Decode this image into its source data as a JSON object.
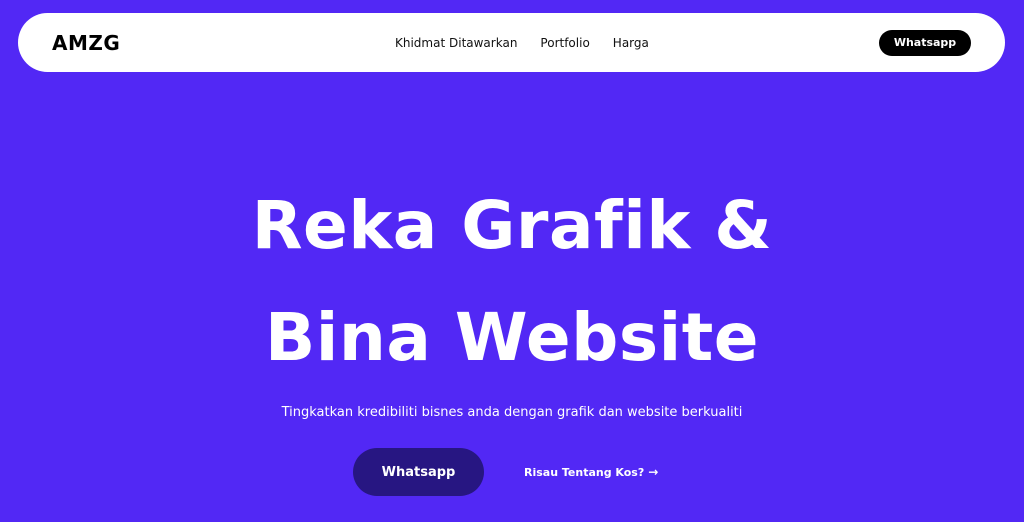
{
  "brand": {
    "logo": "AMZG"
  },
  "nav": {
    "links": [
      "Khidmat Ditawarkan",
      "Portfolio",
      "Harga"
    ],
    "cta_label": "Whatsapp"
  },
  "hero": {
    "title_line1": "Reka Grafik &",
    "title_line2": "Bina Website",
    "subtitle": "Tingkatkan kredibiliti bisnes anda dengan grafik dan website berkualiti",
    "primary_label": "Whatsapp",
    "secondary_label": "Risau Tentang Kos?",
    "secondary_icon": "arrow-right-icon"
  },
  "colors": {
    "background": "#5228F5",
    "primary_button": "#271682",
    "nav_background": "#FFFFFF",
    "nav_cta": "#000000"
  }
}
